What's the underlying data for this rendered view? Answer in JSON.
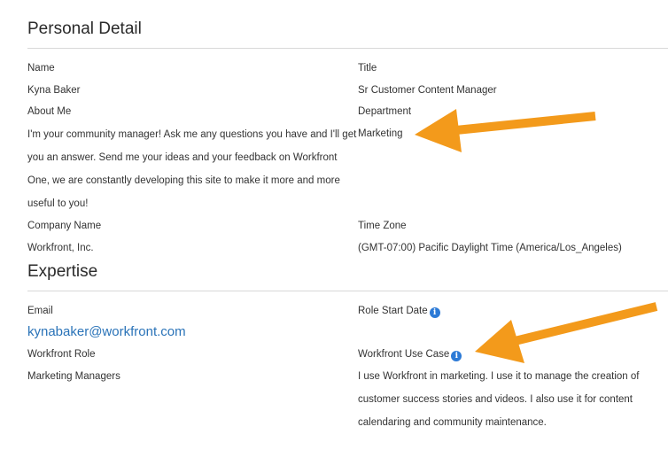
{
  "personal_detail": {
    "title": "Personal Detail",
    "name_label": "Name",
    "name_value": "Kyna Baker",
    "title_label": "Title",
    "title_value": "Sr Customer Content Manager",
    "about_label": "About Me",
    "about_value": "I'm your community manager! Ask me any questions you have and I'll get you an answer. Send me your ideas and your feedback on Workfront One, we are constantly developing this site to make it more and more useful to you!",
    "department_label": "Department",
    "department_value": "Marketing",
    "company_label": "Company Name",
    "company_value": "Workfront, Inc.",
    "timezone_label": "Time Zone",
    "timezone_value": "(GMT-07:00) Pacific Daylight Time (America/Los_Angeles)"
  },
  "expertise": {
    "title": "Expertise",
    "email_label": "Email",
    "email_value": "kynabaker@workfront.com",
    "role_start_label": "Role Start Date",
    "role_label": "Workfront Role",
    "role_value": "Marketing Managers",
    "use_case_label": "Workfront Use Case",
    "use_case_value": "I use Workfront in marketing. I use it to manage the creation of customer success stories and videos. I also use it for content calendaring and community maintenance."
  },
  "icons": {
    "info": "i",
    "info_color": "#2c7ad6"
  },
  "colors": {
    "arrow": "#f39a1b",
    "link": "#2a73b8"
  }
}
